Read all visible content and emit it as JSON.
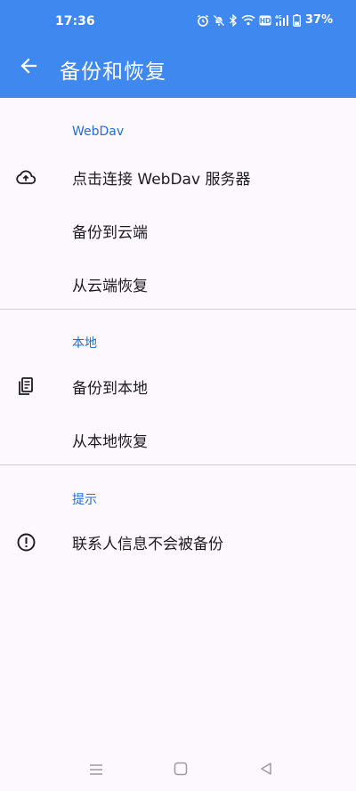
{
  "status_bar": {
    "time": "17:36",
    "battery_percent": "37%",
    "hd_badge": "HD",
    "network_label": "4G",
    "icons": [
      "alarm-icon",
      "bell-muted-icon",
      "bluetooth-icon",
      "wifi-icon",
      "hd-badge-icon",
      "signal-icon",
      "battery-icon"
    ]
  },
  "app_bar": {
    "title": "备份和恢复",
    "back_icon": "arrow-left-icon"
  },
  "sections": {
    "webdav": {
      "header": "WebDav",
      "items": [
        {
          "label": "点击连接 WebDav 服务器",
          "icon": "cloud-upload-icon"
        },
        {
          "label": "备份到云端"
        },
        {
          "label": "从云端恢复"
        }
      ]
    },
    "local": {
      "header": "本地",
      "items": [
        {
          "label": "备份到本地",
          "icon": "document-stack-icon"
        },
        {
          "label": "从本地恢复"
        }
      ]
    },
    "tips": {
      "header": "提示",
      "items": [
        {
          "label": "联系人信息不会被备份",
          "icon": "info-exclamation-icon"
        }
      ]
    }
  },
  "nav_bar": {
    "buttons": [
      "menu-icon",
      "home-square-icon",
      "back-triangle-icon"
    ]
  },
  "colors": {
    "header_blue": "#3f88f0",
    "accent_text": "#1f6fd6",
    "background": "#fdf8fd",
    "divider": "#cfcfd3"
  }
}
